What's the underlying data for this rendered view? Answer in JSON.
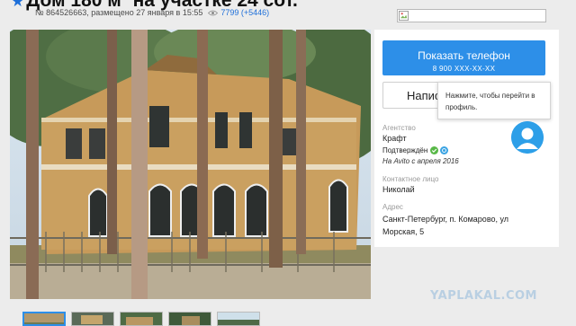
{
  "listing": {
    "title": "Дом 180 м² на участке 24 сот.",
    "meta": "№ 864526663, размещено 27 января в 15:55",
    "views": "7799 (+5446)"
  },
  "contact": {
    "phone_button_label": "Показать телефон",
    "phone_masked": "8 900 XXX-XX-XX",
    "message_button_label": "Написать",
    "tooltip": "Нажмите, чтобы перейти в профиль."
  },
  "seller": {
    "agency_label": "Агентство",
    "agency_name": "Крафт",
    "verified_label": "Подтверждён",
    "since": "На Avito с апреля 2016",
    "contact_label": "Контактное лицо",
    "contact_name": "Николай",
    "address_label": "Адрес",
    "address": "Санкт-Петербург, п. Комарово, ул Морская, 5"
  },
  "colors": {
    "accent": "#2d8fe8",
    "link": "#1e6fd9",
    "verified_green": "#58b847",
    "verified_blue": "#3aa3e3"
  },
  "watermark": "YAPLAKAL.COM"
}
